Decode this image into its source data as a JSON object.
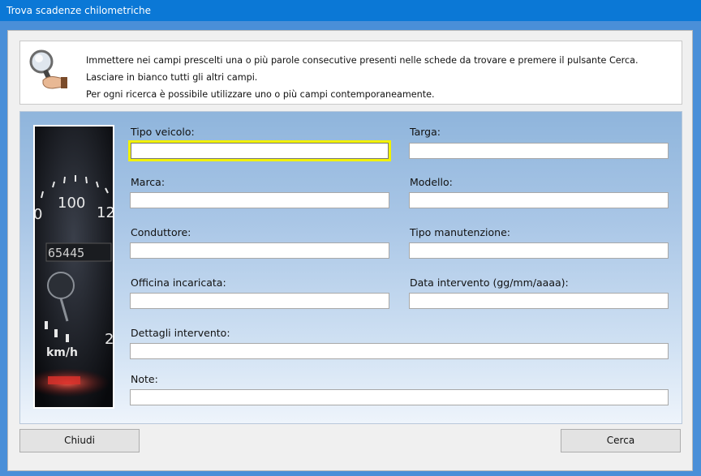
{
  "window": {
    "title": "Trova scadenze chilometriche"
  },
  "info": {
    "lines": [
      "Immettere nei campi prescelti una o più parole consecutive presenti nelle schede da trovare e premere il pulsante Cerca.",
      "Lasciare in bianco tutti gli altri campi.",
      "Per ogni ricerca è possibile utilizzare uno o più campi contemporaneamente."
    ],
    "icon": "magnifier-hand-icon"
  },
  "photo": {
    "speed_labels": [
      "0",
      "100",
      "12",
      "65445",
      "2",
      "km/h"
    ]
  },
  "fields": {
    "tipo_veicolo": {
      "label": "Tipo veicolo:",
      "value": ""
    },
    "targa": {
      "label": "Targa:",
      "value": ""
    },
    "marca": {
      "label": "Marca:",
      "value": ""
    },
    "modello": {
      "label": "Modello:",
      "value": ""
    },
    "conduttore": {
      "label": "Conduttore:",
      "value": ""
    },
    "tipo_manutenzione": {
      "label": "Tipo manutenzione:",
      "value": ""
    },
    "officina": {
      "label": "Officina incaricata:",
      "value": ""
    },
    "data_intervento": {
      "label": "Data intervento (gg/mm/aaaa):",
      "value": ""
    },
    "dettagli": {
      "label": "Dettagli intervento:",
      "value": ""
    },
    "note": {
      "label": "Note:",
      "value": ""
    }
  },
  "buttons": {
    "close": "Chiudi",
    "search": "Cerca"
  },
  "colors": {
    "titlebar": "#0b78d6",
    "focus_highlight": "#f2f200",
    "panel_top": "#8fb5dc"
  }
}
